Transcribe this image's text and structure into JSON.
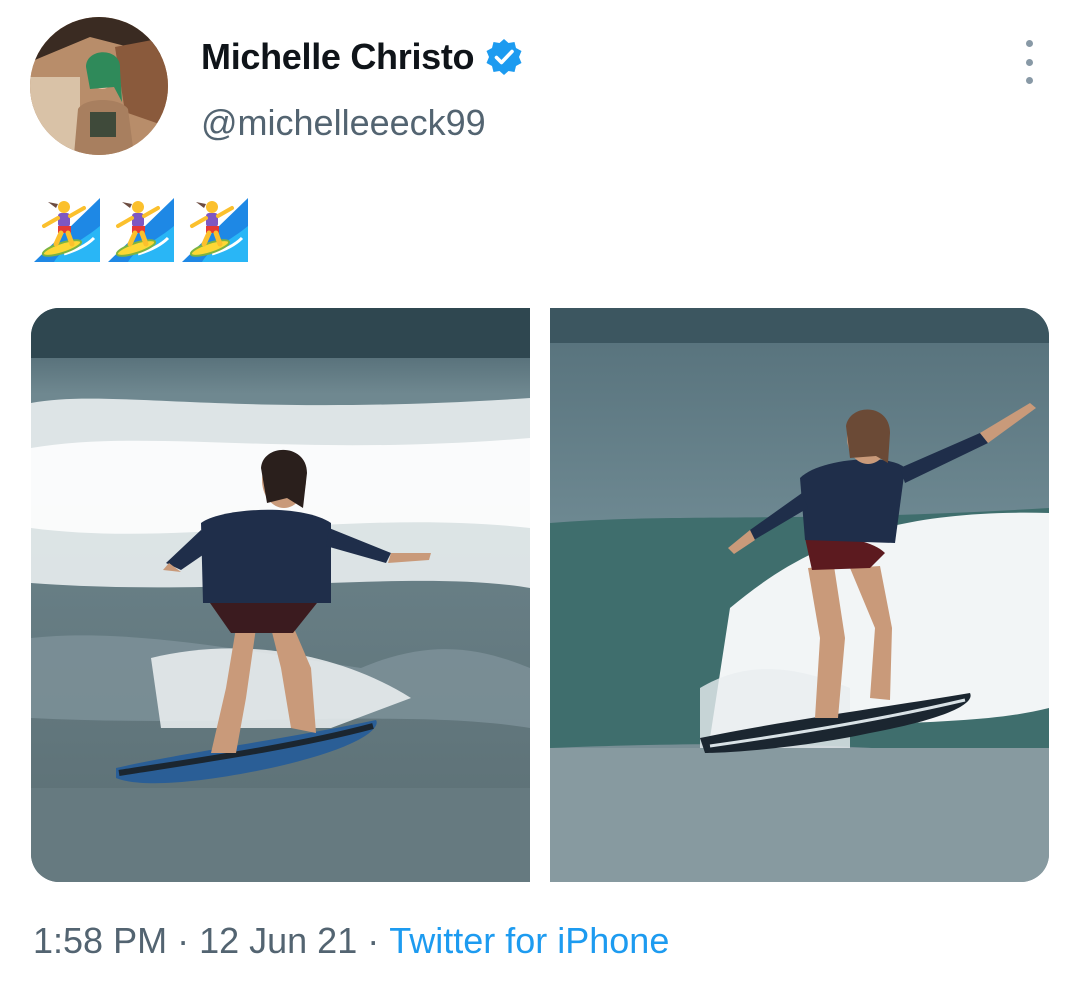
{
  "author": {
    "display_name": "Michelle Christo",
    "handle": "@michelleeeck99",
    "verified": true,
    "verified_color": "#1d9bf0"
  },
  "tweet": {
    "text": "🏄‍♀️🏄‍♀️🏄‍♀️",
    "emoji_icons": [
      "woman-surfing-icon",
      "woman-surfing-icon",
      "woman-surfing-icon"
    ],
    "media_count": 2
  },
  "meta": {
    "time": "1:58 PM",
    "separator": " · ",
    "date": "12 Jun 21",
    "source": "Twitter for iPhone"
  },
  "colors": {
    "text_primary": "#0f1419",
    "text_secondary": "#536471",
    "link": "#1d9bf0"
  }
}
